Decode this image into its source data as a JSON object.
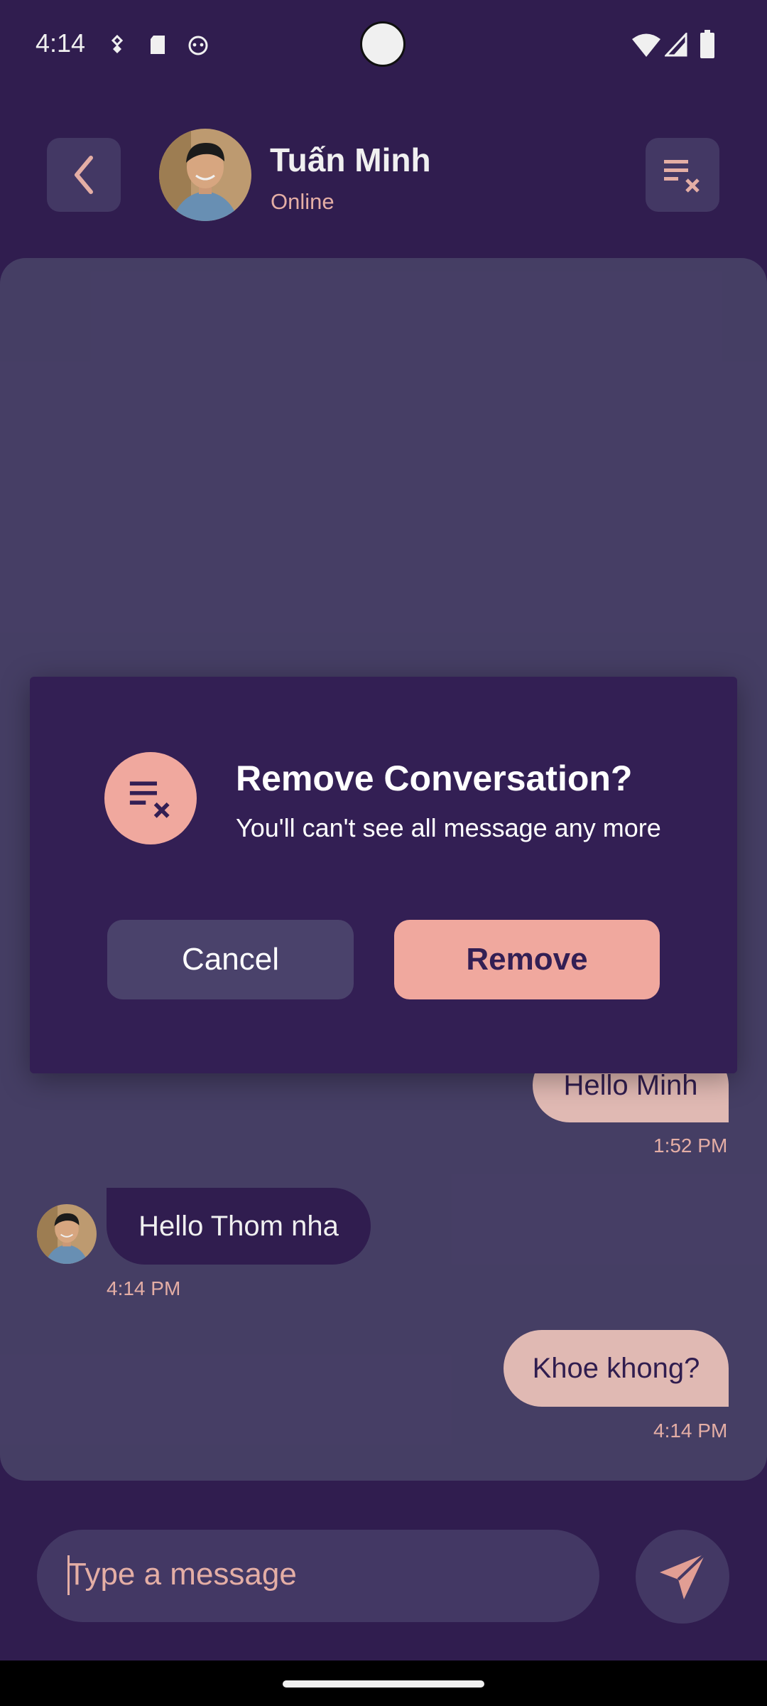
{
  "status_bar": {
    "time": "4:14",
    "left_icons": [
      "usb-debug-icon",
      "sd-card-icon",
      "app-notification-icon"
    ],
    "right_icons": [
      "wifi-icon",
      "cell-signal-icon",
      "battery-icon"
    ]
  },
  "header": {
    "back_icon": "chevron-left-icon",
    "contact_name": "Tuấn Minh",
    "presence": "Online",
    "clear_icon": "clear-all-icon"
  },
  "messages": [
    {
      "direction": "outgoing",
      "text": "Hello Minh",
      "time": "1:52 PM"
    },
    {
      "direction": "incoming",
      "text": "Hello Thom nha",
      "time": "4:14 PM"
    },
    {
      "direction": "outgoing",
      "text": "Khoe khong?",
      "time": "4:14 PM"
    }
  ],
  "composer": {
    "placeholder": "Type a message",
    "send_icon": "send-icon"
  },
  "dialog": {
    "icon": "clear-all-icon",
    "title": "Remove Conversation?",
    "message": "You'll can't see all message any more",
    "cancel_label": "Cancel",
    "confirm_label": "Remove"
  },
  "colors": {
    "background": "#331f54",
    "panel": "#4a426b",
    "accent": "#f0a89e",
    "outgoing_bubble": "#efc5bf",
    "secondary_text": "#f3b9b0"
  }
}
